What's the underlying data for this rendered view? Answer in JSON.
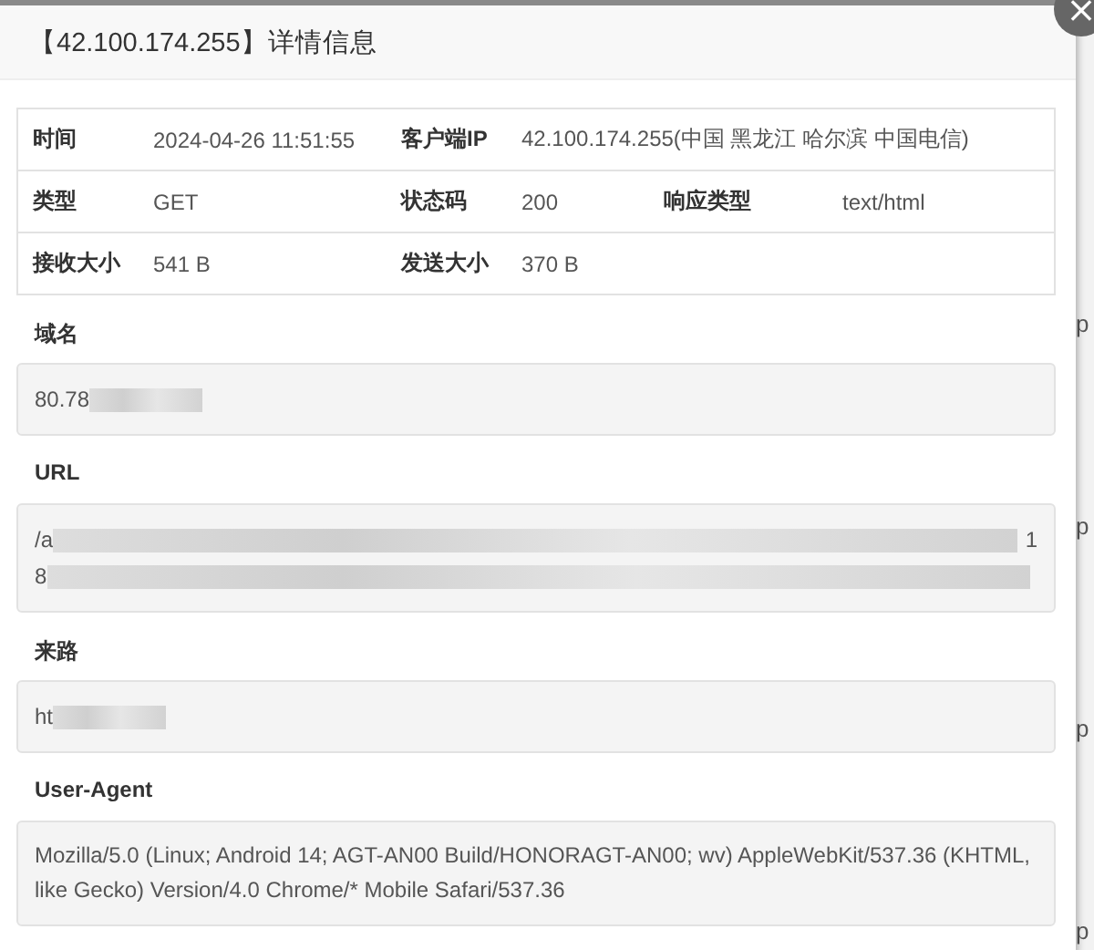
{
  "dialog": {
    "title": "【42.100.174.255】详情信息",
    "close_icon": "×"
  },
  "summary": [
    [
      {
        "label": "时间",
        "value": "2024-04-26 11:51:55"
      },
      {
        "label": "客户端IP",
        "value": "42.100.174.255(中国 黑龙江 哈尔滨 中国电信)"
      }
    ],
    [
      {
        "label": "类型",
        "value": "GET"
      },
      {
        "label": "状态码",
        "value": "200"
      },
      {
        "label": "响应类型",
        "value": "text/html"
      }
    ],
    [
      {
        "label": "接收大小",
        "value": "541 B"
      },
      {
        "label": "发送大小",
        "value": "370 B"
      }
    ]
  ],
  "fields": [
    {
      "label": "域名",
      "lines": [
        {
          "start": "80.78"
        }
      ]
    },
    {
      "label": "URL",
      "lines": [
        {
          "start": "/a",
          "end": "1"
        },
        {
          "start": "8"
        }
      ]
    },
    {
      "label": "来路",
      "lines": [
        {
          "start": "ht"
        }
      ]
    },
    {
      "label": "User-Agent",
      "value": "Mozilla/5.0 (Linux; Android 14; AGT-AN00 Build/HONORAGT-AN00; wv) AppleWebKit/537.36 (KHTML, like Gecko) Version/4.0 Chrome/* Mobile Safari/537.36"
    }
  ],
  "background_letters": [
    "p",
    "p",
    "p",
    "p"
  ]
}
